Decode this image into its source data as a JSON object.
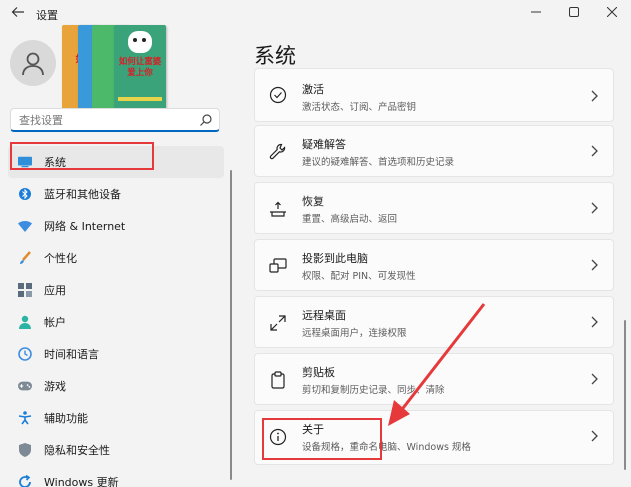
{
  "window": {
    "title": "设置",
    "controls": [
      "minimize-icon",
      "maximize-icon",
      "close-icon"
    ]
  },
  "promo": {
    "book_text": "如何让富婆爱上你",
    "book_texts": [
      "如",
      "富",
      "如何让富婆爱上你"
    ]
  },
  "search": {
    "placeholder": "查找设置"
  },
  "sidebar": {
    "items": [
      {
        "label": "系统",
        "icon": "display-icon",
        "selected": true
      },
      {
        "label": "蓝牙和其他设备",
        "icon": "bluetooth-icon"
      },
      {
        "label": "网络 & Internet",
        "icon": "wifi-icon"
      },
      {
        "label": "个性化",
        "icon": "brush-icon"
      },
      {
        "label": "应用",
        "icon": "apps-icon"
      },
      {
        "label": "帐户",
        "icon": "person-icon"
      },
      {
        "label": "时间和语言",
        "icon": "globe-clock-icon"
      },
      {
        "label": "游戏",
        "icon": "gamepad-icon"
      },
      {
        "label": "辅助功能",
        "icon": "accessibility-icon"
      },
      {
        "label": "隐私和安全性",
        "icon": "shield-icon"
      },
      {
        "label": "Windows 更新",
        "icon": "update-icon"
      }
    ]
  },
  "main": {
    "title": "系统",
    "cards": [
      {
        "title": "激活",
        "subtitle": "激活状态、订阅、产品密钥",
        "icon": "check-circle-icon"
      },
      {
        "title": "疑难解答",
        "subtitle": "建议的疑难解答、首选项和历史记录",
        "icon": "wrench-icon"
      },
      {
        "title": "恢复",
        "subtitle": "重置、高级启动、返回",
        "icon": "recovery-icon"
      },
      {
        "title": "投影到此电脑",
        "subtitle": "权限、配对 PIN、可发现性",
        "icon": "project-icon"
      },
      {
        "title": "远程桌面",
        "subtitle": "远程桌面用户，连接权限",
        "icon": "remote-desktop-icon"
      },
      {
        "title": "剪贴板",
        "subtitle": "剪切和复制历史记录、同步、清除",
        "icon": "clipboard-icon"
      },
      {
        "title": "关于",
        "subtitle": "设备规格，重命名电脑、Windows 规格",
        "icon": "info-icon"
      }
    ]
  },
  "colors": {
    "accent": "#0067c0",
    "highlight": "#e5393b",
    "arrow": "#e5393b"
  }
}
